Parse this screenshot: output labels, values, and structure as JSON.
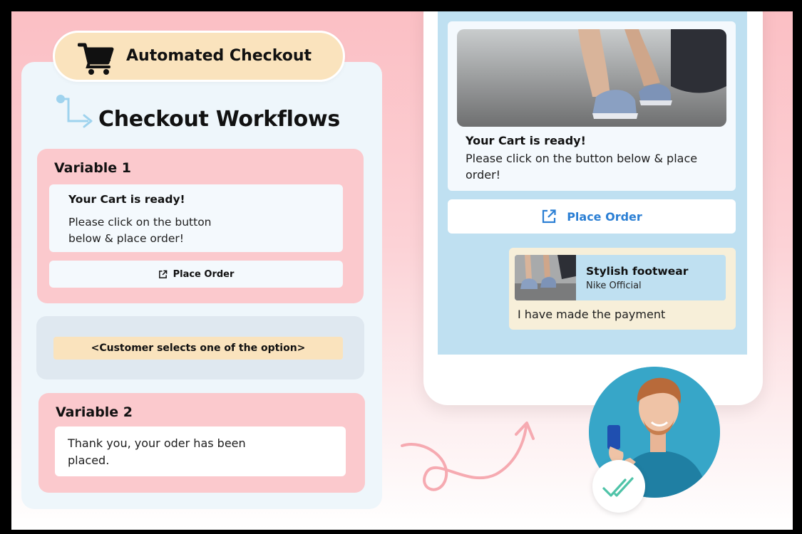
{
  "header": {
    "title": "Automated Checkout"
  },
  "workflow": {
    "title": "Checkout Workflows"
  },
  "variable1": {
    "label": "Variable 1",
    "message_title": "Your Cart is ready!",
    "message_body": "Please click on the button below & place order!",
    "button_label": "Place Order"
  },
  "condition": {
    "label": "<Customer selects one of the option>"
  },
  "variable2": {
    "label": "Variable 2",
    "message_body": "Thank you, your oder has been placed."
  },
  "phone": {
    "message_title": "Your Cart is ready!",
    "message_body": "Please click on the button below & place order!",
    "button_label": "Place Order",
    "reply": {
      "quoted_title": "Stylish footwear",
      "quoted_subtitle": "Nike Official",
      "text": "I have made the payment"
    }
  },
  "colors": {
    "header_pill": "#fae3bd",
    "variable_card": "#fbc9cd",
    "condition_card": "#dfe8f0",
    "phone_screen": "#bfe0f1",
    "button_text": "#2b7fd4",
    "check": "#4fc3a8"
  }
}
